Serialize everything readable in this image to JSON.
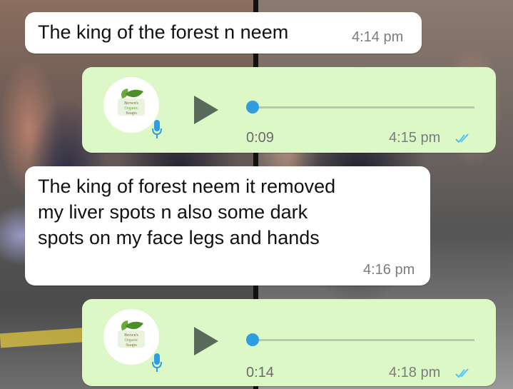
{
  "messages": [
    {
      "type": "text",
      "direction": "incoming",
      "text": "The king of the forest n neem",
      "time": "4:14 pm"
    },
    {
      "type": "voice",
      "direction": "outgoing",
      "duration": "0:09",
      "time": "4:15 pm",
      "progress": 0.0,
      "read": true
    },
    {
      "type": "text",
      "direction": "incoming",
      "lines": [
        "The king of forest neem it removed",
        "my liver spots n also some dark",
        "spots on my face legs and hands"
      ],
      "time": "4:16 pm"
    },
    {
      "type": "voice",
      "direction": "outgoing",
      "duration": "0:14",
      "time": "4:18 pm",
      "progress": 0.0,
      "read": true
    }
  ],
  "avatar_logo": {
    "lines": [
      "Brown's",
      "Organic",
      "Soaps"
    ]
  },
  "colors": {
    "outgoing_bubble": "#dcf8c6",
    "incoming_bubble": "#ffffff",
    "play_icon": "#5a6a5a",
    "progress_knob": "#2f9de0",
    "mic_icon": "#2f9de0",
    "read_ticks": "#4fc3f7",
    "logo_leaf": "#6fa83a",
    "logo_text": "#7a6a3a"
  }
}
